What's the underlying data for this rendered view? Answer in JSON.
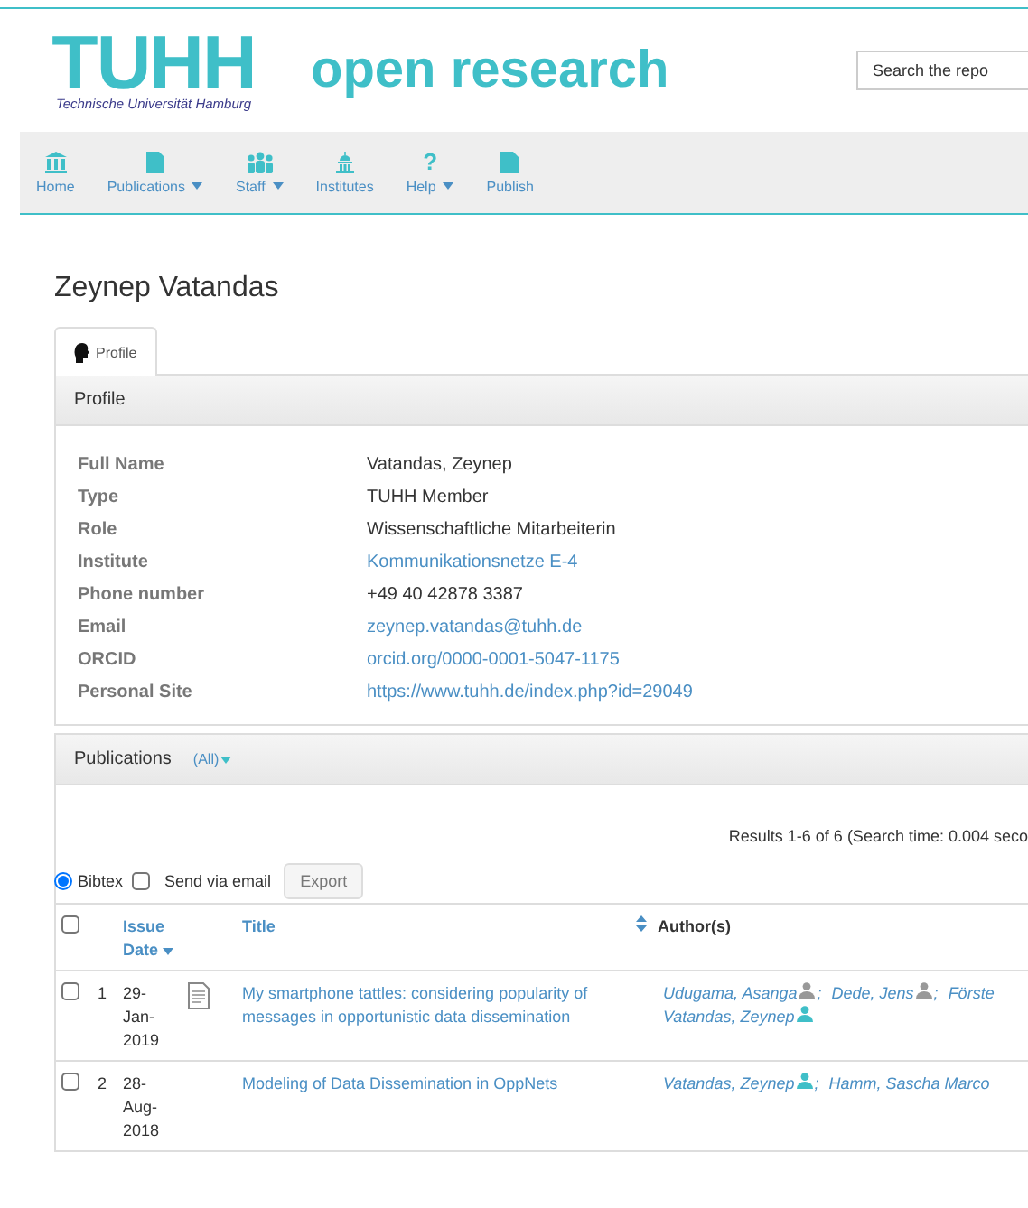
{
  "header": {
    "logo_text": "TUHH",
    "logo_subtitle": "Technische Universität Hamburg",
    "site_title": "open research",
    "search": {
      "placeholder": "Search the repo"
    }
  },
  "nav": [
    {
      "label": "Home",
      "kind": "home",
      "dropdown": false
    },
    {
      "label": "Publications",
      "kind": "document",
      "dropdown": true
    },
    {
      "label": "Staff",
      "kind": "people",
      "dropdown": true
    },
    {
      "label": "Institutes",
      "kind": "building",
      "dropdown": false
    },
    {
      "label": "Help",
      "kind": "glyph",
      "glyph": "?",
      "dropdown": true
    },
    {
      "label": "Publish",
      "kind": "document",
      "dropdown": false
    }
  ],
  "page_title": "Zeynep Vatandas",
  "tabs": [
    {
      "label": "Profile",
      "selected": true
    }
  ],
  "profile": {
    "title": "Profile",
    "fields": [
      {
        "label": "Full Name",
        "value": "Vatandas, Zeynep",
        "link": false
      },
      {
        "label": "Type",
        "value": "TUHH Member",
        "link": false
      },
      {
        "label": "Role",
        "value": "Wissenschaftliche Mitarbeiterin",
        "link": false
      },
      {
        "label": "Institute",
        "value": "Kommunikationsnetze E-4",
        "link": true
      },
      {
        "label": "Phone number",
        "value": "+49 40 42878 3387",
        "link": false
      },
      {
        "label": "Email",
        "value": "zeynep.vatandas@tuhh.de",
        "link": true
      },
      {
        "label": "ORCID",
        "value": "orcid.org/0000-0001-5047-1175",
        "link": true
      },
      {
        "label": "Personal Site",
        "value": "https://www.tuhh.de/index.php?id=29049",
        "link": true
      }
    ]
  },
  "publications": {
    "title": "Publications",
    "filter": "(All)",
    "results": "Results 1-6 of 6 (Search time: 0.004 seco",
    "export": {
      "options": [
        {
          "label": "Bibtex",
          "kind": "radio",
          "checked": true
        },
        {
          "label": "Send via email",
          "kind": "checkbox",
          "checked": false
        }
      ],
      "button": "Export"
    },
    "select_all_checked": false,
    "columns": [
      {
        "label": "Issue Date",
        "sorted": true
      },
      {
        "label": "Title",
        "sorted": false
      },
      {
        "label": "Author(s)",
        "sorted": false
      }
    ],
    "rows": [
      {
        "number": "1",
        "date": "29-Jan-2019",
        "checked": false,
        "has_file": true,
        "title": "My smartphone tattles: considering popularity of messages in opportunistic data dissemination",
        "authors": [
          {
            "name": "Udugama, Asanga",
            "color": "#999999",
            "separator": ";"
          },
          {
            "name": "Dede, Jens",
            "color": "#999999",
            "separator": ";"
          },
          {
            "name": "Förste"
          },
          {
            "name": "Vatandas, Zeynep",
            "color": "#3fbfc8"
          }
        ]
      },
      {
        "number": "2",
        "date": "28-Aug-2018",
        "checked": false,
        "has_file": false,
        "title": "Modeling of Data Dissemination in OppNets",
        "authors": [
          {
            "name": "Vatandas, Zeynep",
            "color": "#3fbfc8",
            "separator": ";"
          },
          {
            "name": "Hamm, Sascha Marco"
          }
        ]
      }
    ]
  }
}
